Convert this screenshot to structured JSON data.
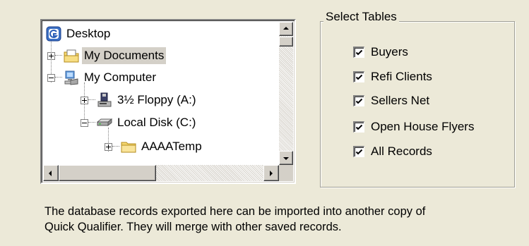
{
  "tree": {
    "items": [
      {
        "label": "Desktop",
        "icon": "desktop-icon",
        "level": 0
      },
      {
        "label": "My Documents",
        "icon": "my-documents-folder-icon",
        "level": 1,
        "toggle": "plus",
        "selected": true
      },
      {
        "label": "My Computer",
        "icon": "my-computer-icon",
        "level": 1,
        "toggle": "minus"
      },
      {
        "label": "3½ Floppy (A:)",
        "icon": "floppy-drive-icon",
        "level": 2,
        "toggle": "plus"
      },
      {
        "label": "Local Disk (C:)",
        "icon": "hard-disk-icon",
        "level": 2,
        "toggle": "minus"
      },
      {
        "label": "AAAATemp",
        "icon": "folder-icon",
        "level": 3,
        "toggle": "plus"
      }
    ]
  },
  "select_tables": {
    "title": "Select Tables",
    "options": [
      {
        "label": "Buyers",
        "checked": true
      },
      {
        "label": "Refi Clients",
        "checked": true
      },
      {
        "label": "Sellers Net",
        "checked": true
      },
      {
        "label": "Open House Flyers",
        "checked": true
      },
      {
        "label": "All Records",
        "checked": true
      }
    ]
  },
  "note": {
    "line1": "The database records exported here can be imported into another copy of",
    "line2": "Quick Qualifier.  They will merge with other saved records."
  },
  "colors": {
    "window_bg": "#ece9d8",
    "selected_bg": "#d4d0c8",
    "folder_yellow": "#f5d76e"
  }
}
